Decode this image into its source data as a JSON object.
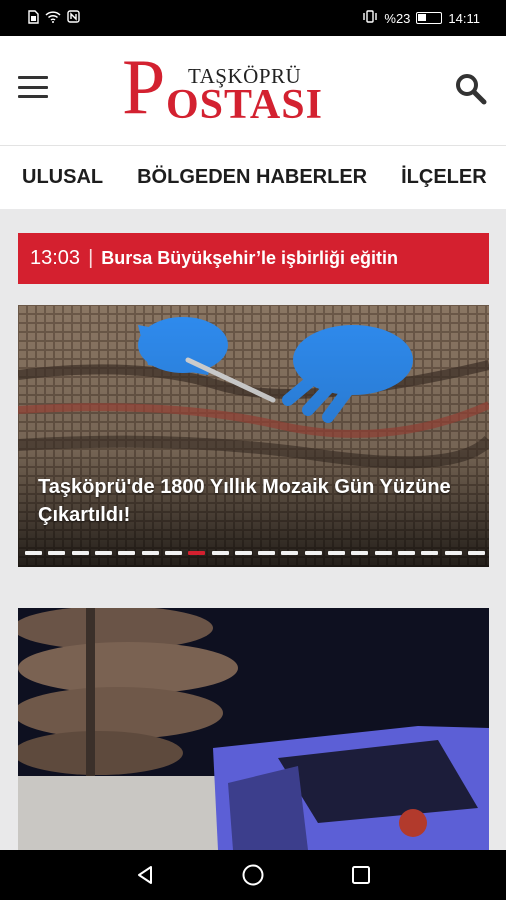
{
  "status_bar": {
    "battery": "%23",
    "time": "14:11"
  },
  "header": {
    "logo_top": "TAŞKÖPRÜ",
    "logo_first_letter": "P",
    "logo_bottom": "OSTASI"
  },
  "nav": {
    "items": [
      "ULUSAL",
      "BÖLGEDEN HABERLER",
      "İLÇELER"
    ]
  },
  "breaking": {
    "time": "13:03",
    "separator": "|",
    "headline": "Bursa Büyükşehir’le işbirliği eğitin"
  },
  "slider": {
    "caption": "Taşköprü'de 1800 Yıllık Mozaik Gün Yüzüne Çıkartıldı!",
    "dot_count": 20,
    "active_dot": 7
  },
  "colors": {
    "brand_red": "#d4202f",
    "glove_blue": "#2f8cf0"
  },
  "icons": {
    "menu": "hamburger-menu-icon",
    "search": "search-icon",
    "back": "back-triangle-icon",
    "home": "home-circle-icon",
    "recents": "recents-square-icon"
  }
}
